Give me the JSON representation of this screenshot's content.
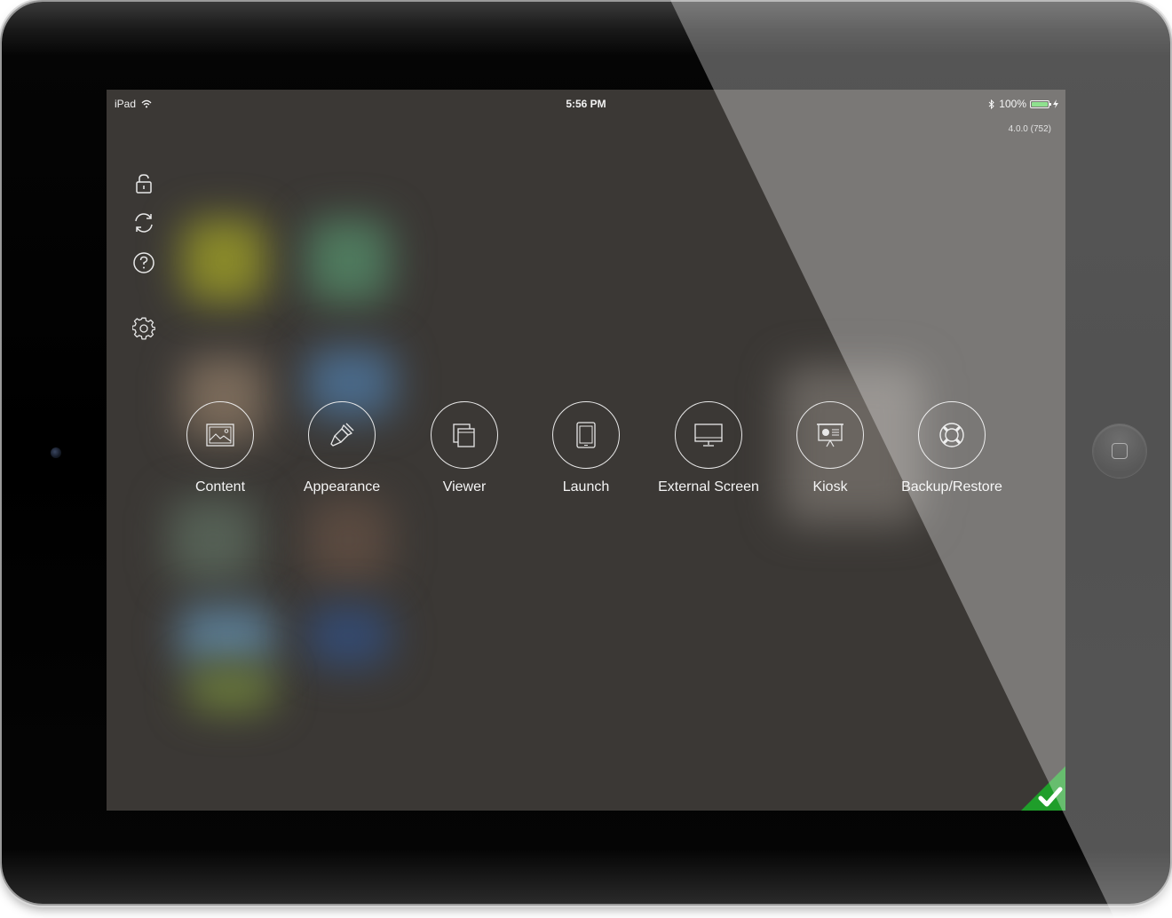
{
  "status_bar": {
    "device": "iPad",
    "time": "5:56 PM",
    "battery_percent": "100%",
    "battery_level": 1.0
  },
  "version": "4.0.0 (752)",
  "side_icons": [
    {
      "icon": "lock-icon"
    },
    {
      "icon": "refresh-icon"
    },
    {
      "icon": "help-icon"
    },
    {
      "icon": "gear-icon"
    }
  ],
  "tiles": [
    {
      "label": "Content",
      "icon": "image-icon"
    },
    {
      "label": "Appearance",
      "icon": "paintbrush-icon"
    },
    {
      "label": "Viewer",
      "icon": "viewer-icon"
    },
    {
      "label": "Launch",
      "icon": "tablet-icon"
    },
    {
      "label": "External Screen",
      "icon": "monitor-icon"
    },
    {
      "label": "Kiosk",
      "icon": "presentation-icon"
    },
    {
      "label": "Backup/Restore",
      "icon": "lifebuoy-icon"
    }
  ],
  "colors": {
    "background": "#3b3835",
    "accent_green": "#1f9e2a",
    "battery_green": "#5bd35b"
  }
}
